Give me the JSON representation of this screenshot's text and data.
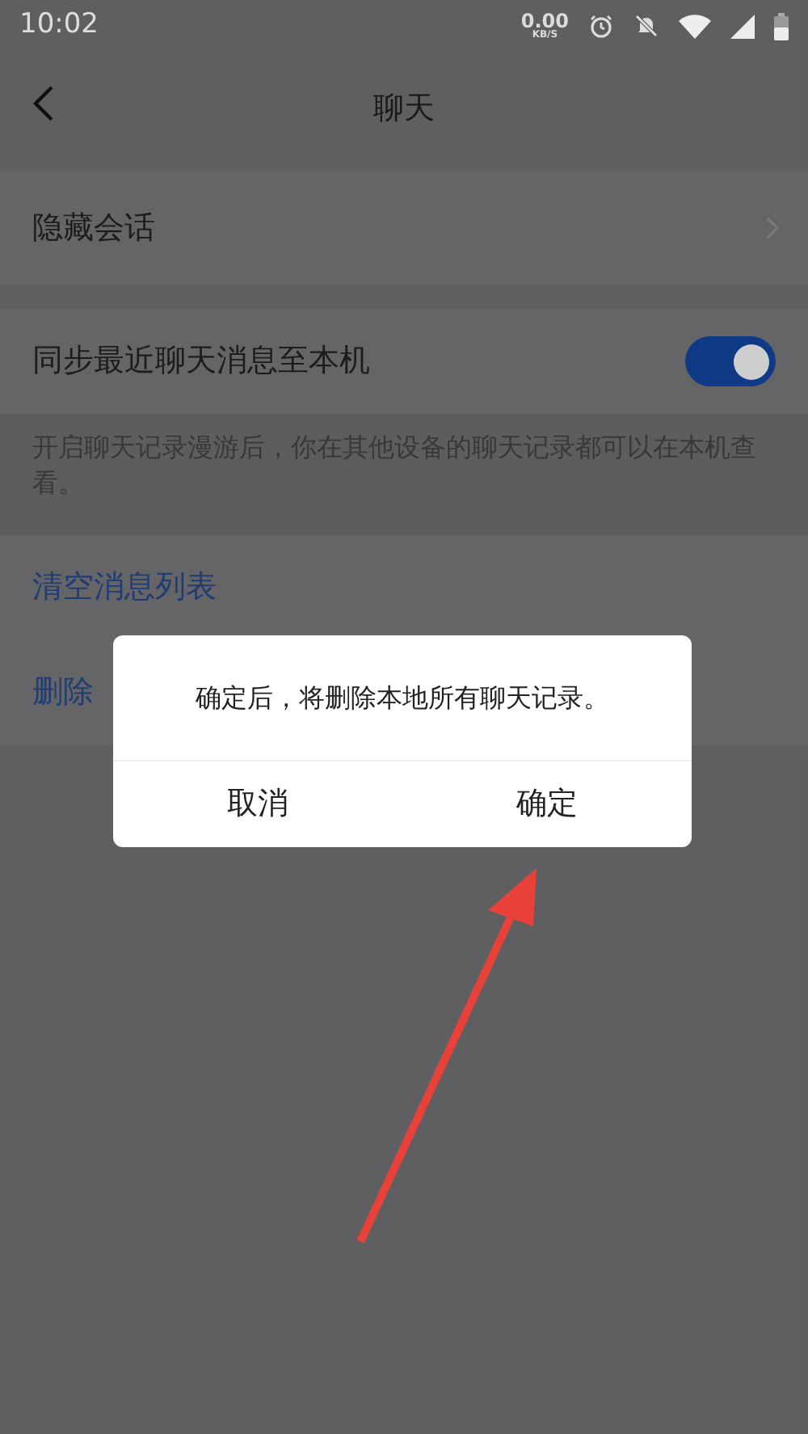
{
  "status_bar": {
    "time": "10:02",
    "net_speed": "0.00",
    "net_unit": "KB/S"
  },
  "header": {
    "title": "聊天"
  },
  "rows": [
    {
      "kind": "link",
      "label": "隐藏会话"
    },
    {
      "kind": "toggle",
      "label": "同步最近聊天消息至本机",
      "on": true,
      "description": "开启聊天记录漫游后，你在其他设备的聊天记录都可以在本机查看。"
    },
    {
      "kind": "action",
      "label": "清空消息列表"
    },
    {
      "kind": "action",
      "label": "删除"
    }
  ],
  "dialog": {
    "message": "确定后，将删除本地所有聊天记录。",
    "buttons": [
      "取消",
      "确定"
    ]
  }
}
